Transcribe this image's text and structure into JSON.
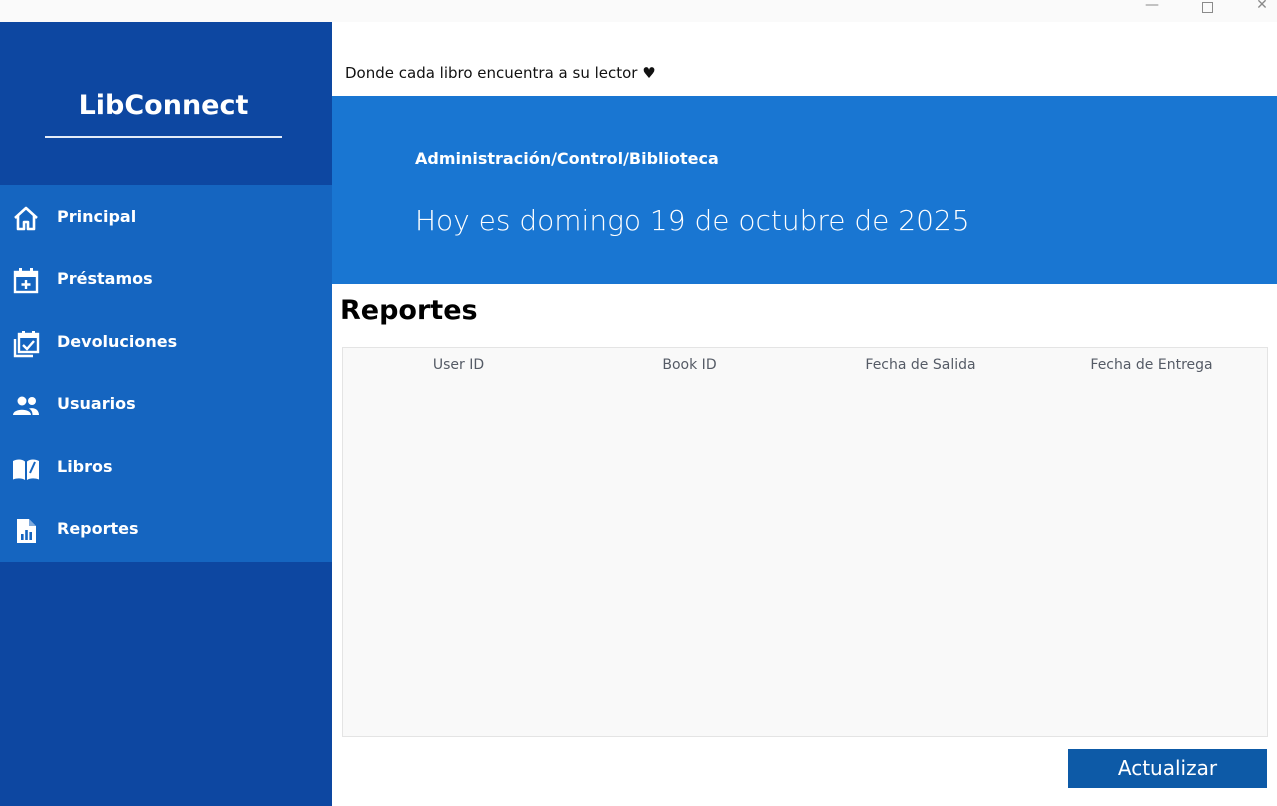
{
  "window": {
    "minimize_glyph": "—",
    "close_glyph": "✕"
  },
  "sidebar": {
    "brand": "LibConnect",
    "items": [
      {
        "label": "Principal",
        "icon": "home-icon"
      },
      {
        "label": "Préstamos",
        "icon": "calendar-add-icon"
      },
      {
        "label": "Devoluciones",
        "icon": "calendar-check-icon"
      },
      {
        "label": "Usuarios",
        "icon": "users-icon"
      },
      {
        "label": "Libros",
        "icon": "book-open-icon"
      },
      {
        "label": "Reportes",
        "icon": "report-chart-icon"
      }
    ]
  },
  "header": {
    "tagline": "Donde cada libro encuentra a su lector ♥",
    "breadcrumb": "Administración/Control/Biblioteca",
    "date": "Hoy es domingo 19 de octubre de 2025"
  },
  "main": {
    "title": "Reportes",
    "table": {
      "columns": [
        "User ID",
        "Book ID",
        "Fecha de Salida",
        "Fecha de Entrega"
      ],
      "rows": []
    },
    "refresh_label": "Actualizar"
  },
  "colors": {
    "sidebar": "#0d47a1",
    "nav": "#1565c0",
    "banner": "#1976d2",
    "button": "#0d5aa7"
  }
}
